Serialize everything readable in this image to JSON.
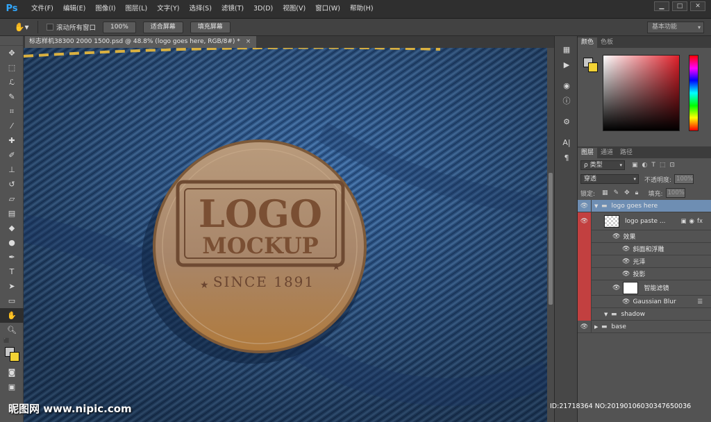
{
  "app": {
    "logo": "Ps"
  },
  "menu": [
    "文件(F)",
    "编辑(E)",
    "图像(I)",
    "图层(L)",
    "文字(Y)",
    "选择(S)",
    "滤镜(T)",
    "3D(D)",
    "视图(V)",
    "窗口(W)",
    "帮助(H)"
  ],
  "window_controls": {
    "minimize": "▁",
    "maximize": "□",
    "close": "✕"
  },
  "options_bar": {
    "scroll_all": "滚动所有窗口",
    "zoom_100": "100%",
    "fit_screen": "适合屏幕",
    "fill_screen": "填充屏幕",
    "workspace": "基本功能"
  },
  "document": {
    "tab_title": "标志样机38300 2000 1500.psd @ 48.8% (logo goes here, RGB/8#) *",
    "close": "×"
  },
  "mockup": {
    "logo_line1": "LOGO",
    "logo_line2": "MOCKUP",
    "since": "SINCE 1891"
  },
  "color_panel": {
    "tabs": [
      "颜色",
      "色板"
    ]
  },
  "layers_panel": {
    "tabs": [
      "图层",
      "通道",
      "路径"
    ],
    "filter_label": "ρ 类型",
    "blend_mode": "穿透",
    "opacity_label": "不透明度:",
    "opacity_value": "100%",
    "lock_label": "锁定:",
    "fill_label": "填充:",
    "fill_value": "100%",
    "layers": [
      {
        "name": "logo goes here",
        "type": "group"
      },
      {
        "name": "logo paste ...",
        "type": "smart"
      },
      {
        "name": "效果",
        "type": "effects"
      },
      {
        "name": "斜面和浮雕",
        "type": "effect"
      },
      {
        "name": "光泽",
        "type": "effect"
      },
      {
        "name": "投影",
        "type": "effect"
      },
      {
        "name": "智能滤镜",
        "type": "smartfilter"
      },
      {
        "name": "Gaussian Blur",
        "type": "filter"
      },
      {
        "name": "shadow",
        "type": "group"
      },
      {
        "name": "base",
        "type": "group"
      }
    ]
  },
  "watermark": {
    "left": "昵图网 www.nipic.com",
    "right": "ID:21718364 NO:20190106030347650036"
  },
  "colors": {
    "accent": "#31a8ff",
    "selected_layer": "#6e8eb3",
    "eye_red": "#c24040",
    "foreground": "#c8c8c8",
    "background": "#f2d234"
  }
}
